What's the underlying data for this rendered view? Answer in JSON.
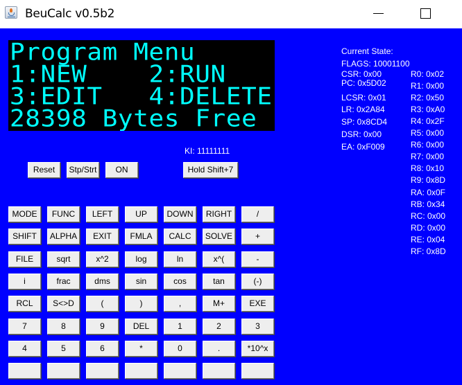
{
  "window": {
    "title": "BeuCalc v0.5b2",
    "minimize_label": "",
    "maximize_label": ""
  },
  "lcd": {
    "lines": [
      "Program Menu",
      "1:NEW    2:RUN",
      "3:EDIT   4:DELETE",
      "28398 Bytes Free"
    ],
    "text_color": "#00ffff",
    "background": "#000000"
  },
  "controls": {
    "reset": "Reset",
    "stop_start": "Stp/Strt",
    "on": "ON",
    "hold_shift_7": "Hold Shift+7",
    "ki": "KI: 11111111"
  },
  "state": {
    "heading": "Current State:",
    "flags": "FLAGS: 10001100",
    "left": [
      "CSR: 0x00",
      "PC: 0x5D02",
      "LCSR: 0x01",
      "LR: 0x2A84",
      "SP: 0x8CD4",
      "DSR: 0x00",
      "EA: 0xF009"
    ],
    "registers": [
      "R0: 0x02",
      "R1: 0x00",
      "R2: 0x50",
      "R3: 0xA0",
      "R4: 0x2F",
      "R5: 0x00",
      "R6: 0x00",
      "R7: 0x00",
      "R8: 0x10",
      "R9: 0x8D",
      "RA: 0x0F",
      "RB: 0x34",
      "RC: 0x00",
      "RD: 0x00",
      "RE: 0x04",
      "RF: 0x8D"
    ]
  },
  "keypad": {
    "rows": [
      [
        "MODE",
        "FUNC",
        "LEFT",
        "UP",
        "DOWN",
        "RIGHT",
        "/"
      ],
      [
        "SHIFT",
        "ALPHA",
        "EXIT",
        "FMLA",
        "CALC",
        "SOLVE",
        "+"
      ],
      [
        "FILE",
        "sqrt",
        "x^2",
        "log",
        "ln",
        "x^(",
        "-"
      ],
      [
        "i",
        "frac",
        "dms",
        "sin",
        "cos",
        "tan",
        "(-)"
      ],
      [
        "RCL",
        "S<>D",
        "(",
        ")",
        ",",
        "M+",
        "EXE"
      ],
      [
        "7",
        "8",
        "9",
        "DEL",
        "1",
        "2",
        "3"
      ],
      [
        "4",
        "5",
        "6",
        "*",
        "0",
        ".",
        "*10^x"
      ],
      [
        "",
        "",
        "",
        "",
        "",
        "",
        ""
      ]
    ]
  },
  "colors": {
    "background": "#0000ff",
    "button_face": "#eeeeee",
    "lcd_text": "#00ffff"
  }
}
